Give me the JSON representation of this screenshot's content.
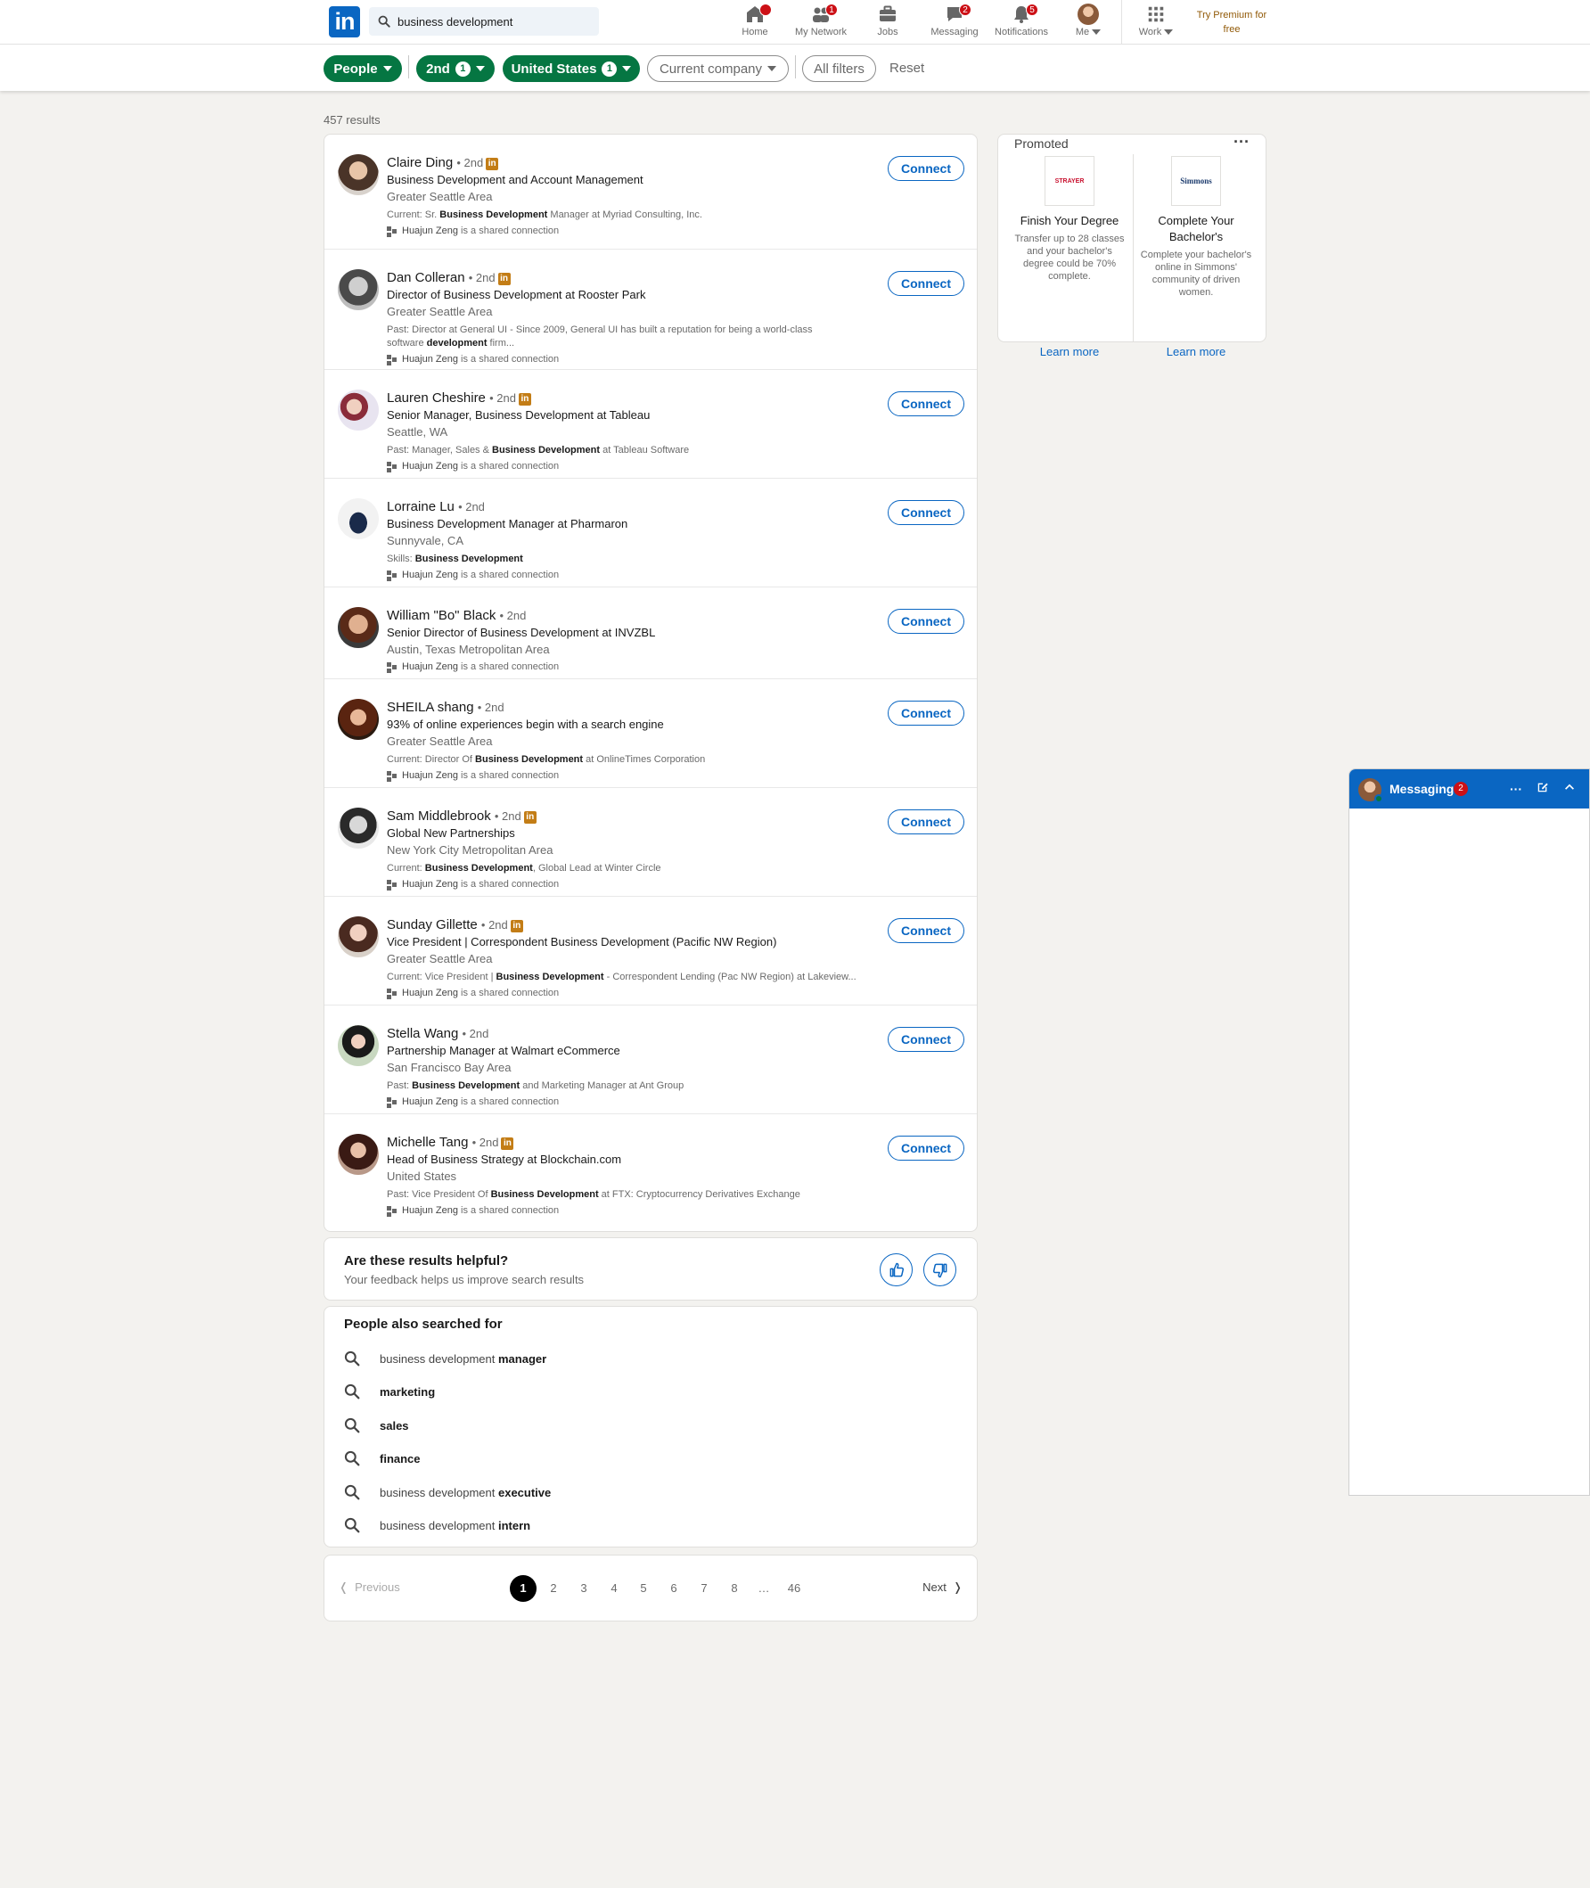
{
  "nav": {
    "logo": "in",
    "search_value": "business development",
    "items": [
      {
        "label": "Home",
        "icon": "home-icon",
        "badge": ""
      },
      {
        "label": "My Network",
        "icon": "network-icon",
        "badge": "1"
      },
      {
        "label": "Jobs",
        "icon": "briefcase-icon",
        "badge": ""
      },
      {
        "label": "Messaging",
        "icon": "chat-icon",
        "badge": "2"
      },
      {
        "label": "Notifications",
        "icon": "bell-icon",
        "badge": "5"
      },
      {
        "label": "Me",
        "icon": "avatar",
        "badge": ""
      },
      {
        "label": "Work",
        "icon": "grid-icon",
        "badge": ""
      }
    ],
    "premium": "Try Premium for free"
  },
  "filters": {
    "people": "People",
    "degree": "2nd",
    "degree_count": "1",
    "location": "United States",
    "location_count": "1",
    "company": "Current company",
    "all": "All filters",
    "reset": "Reset"
  },
  "results": {
    "count": "457 results",
    "connect_label": "Connect",
    "items": [
      {
        "name": "Claire Ding",
        "degree": "• 2nd",
        "premium": true,
        "title": "Business Development and Account Management",
        "location": "Greater Seattle Area",
        "summary_pre": "Current: Sr. ",
        "summary_bold": "Business Development",
        "summary_post": " Manager at Myriad Consulting, Inc.",
        "shared_name": "Huajun Zeng",
        "shared_suffix": " is a shared connection"
      },
      {
        "name": "Dan Colleran",
        "degree": "• 2nd",
        "premium": true,
        "title": "Director of Business Development at Rooster Park",
        "location": "Greater Seattle Area",
        "summary_pre": "Past: Director at General UI - Since 2009, General UI has built a reputation for being a world-class software ",
        "summary_bold": "development",
        "summary_post": " firm...",
        "shared_name": "Huajun Zeng",
        "shared_suffix": " is a shared connection"
      },
      {
        "name": "Lauren Cheshire",
        "degree": "• 2nd",
        "premium": true,
        "title": "Senior Manager, Business Development at Tableau",
        "location": "Seattle, WA",
        "summary_pre": "Past: Manager, Sales & ",
        "summary_bold": "Business Development",
        "summary_post": " at Tableau Software",
        "shared_name": "Huajun Zeng",
        "shared_suffix": " is a shared connection"
      },
      {
        "name": "Lorraine Lu",
        "degree": "• 2nd",
        "premium": false,
        "title": "Business Development Manager at Pharmaron",
        "location": "Sunnyvale, CA",
        "summary_pre": "Skills: ",
        "summary_bold": "Business Development",
        "summary_post": "",
        "shared_name": "Huajun Zeng",
        "shared_suffix": " is a shared connection"
      },
      {
        "name": "William \"Bo\" Black",
        "degree": "• 2nd",
        "premium": false,
        "title": "Senior Director of Business Development at INVZBL",
        "location": "Austin, Texas Metropolitan Area",
        "summary_pre": "",
        "summary_bold": "",
        "summary_post": "",
        "shared_name": "Huajun Zeng",
        "shared_suffix": " is a shared connection"
      },
      {
        "name": "SHEILA shang",
        "degree": "• 2nd",
        "premium": false,
        "title": "93% of online experiences begin with a search engine",
        "location": "Greater Seattle Area",
        "summary_pre": "Current: Director Of ",
        "summary_bold": "Business Development",
        "summary_post": " at OnlineTimes Corporation",
        "shared_name": "Huajun Zeng",
        "shared_suffix": " is a shared connection"
      },
      {
        "name": "Sam Middlebrook",
        "degree": "• 2nd",
        "premium": true,
        "title": "Global New Partnerships",
        "location": "New York City Metropolitan Area",
        "summary_pre": "Current: ",
        "summary_bold": "Business Development",
        "summary_post": ", Global Lead at Winter Circle",
        "shared_name": "Huajun Zeng",
        "shared_suffix": " is a shared connection"
      },
      {
        "name": "Sunday Gillette",
        "degree": "• 2nd",
        "premium": true,
        "title": "Vice President | Correspondent Business Development (Pacific NW Region)",
        "location": "Greater Seattle Area",
        "summary_pre": "Current: Vice President | ",
        "summary_bold": "Business Development",
        "summary_post": " - Correspondent Lending (Pac NW Region) at Lakeview...",
        "shared_name": "Huajun Zeng",
        "shared_suffix": " is a shared connection"
      },
      {
        "name": "Stella Wang",
        "degree": "• 2nd",
        "premium": false,
        "title": "Partnership Manager at Walmart eCommerce",
        "location": "San Francisco Bay Area",
        "summary_pre": "Past: ",
        "summary_bold": "Business Development",
        "summary_post": " and Marketing Manager at Ant Group",
        "shared_name": "Huajun Zeng",
        "shared_suffix": " is a shared connection"
      },
      {
        "name": "Michelle Tang",
        "degree": "• 2nd",
        "premium": true,
        "title": "Head of Business Strategy at Blockchain.com",
        "location": "United States",
        "summary_pre": "Past: Vice President Of ",
        "summary_bold": "Business Development",
        "summary_post": " at FTX: Cryptocurrency Derivatives Exchange",
        "shared_name": "Huajun Zeng",
        "shared_suffix": " is a shared connection"
      }
    ]
  },
  "feedback": {
    "title": "Are these results helpful?",
    "subtitle": "Your feedback helps us improve search results"
  },
  "also": {
    "title": "People also searched for",
    "items": [
      {
        "pre": "business development ",
        "bold": "manager"
      },
      {
        "pre": "",
        "bold": "marketing"
      },
      {
        "pre": "",
        "bold": "sales"
      },
      {
        "pre": "",
        "bold": "finance"
      },
      {
        "pre": "business development ",
        "bold": "executive"
      },
      {
        "pre": "business development ",
        "bold": "intern"
      }
    ]
  },
  "pagination": {
    "previous": "Previous",
    "next": "Next",
    "pages": [
      "1",
      "2",
      "3",
      "4",
      "5",
      "6",
      "7",
      "8",
      "…",
      "46"
    ],
    "current": "1"
  },
  "promoted": {
    "title": "Promoted",
    "more": "···",
    "ads": [
      {
        "logo": "STRAYER",
        "logo_color": "#c8102e",
        "headline": "Finish Your Degree",
        "desc": "Transfer up to 28 classes and your bachelor's degree could be 70% complete.",
        "cta": "Learn more"
      },
      {
        "logo": "Simmons",
        "logo_color": "#1d3c6e",
        "headline": "Complete Your Bachelor's",
        "desc": "Complete your bachelor's online in Simmons' community of driven women.",
        "cta": "Learn more"
      }
    ]
  },
  "messaging": {
    "title": "Messaging",
    "badge": "2"
  },
  "colors": {
    "brand": "#0a66c2",
    "filter_active": "#057642",
    "premium": "#915907",
    "premium_badge": "#c37d16",
    "notification": "#cc1016"
  }
}
